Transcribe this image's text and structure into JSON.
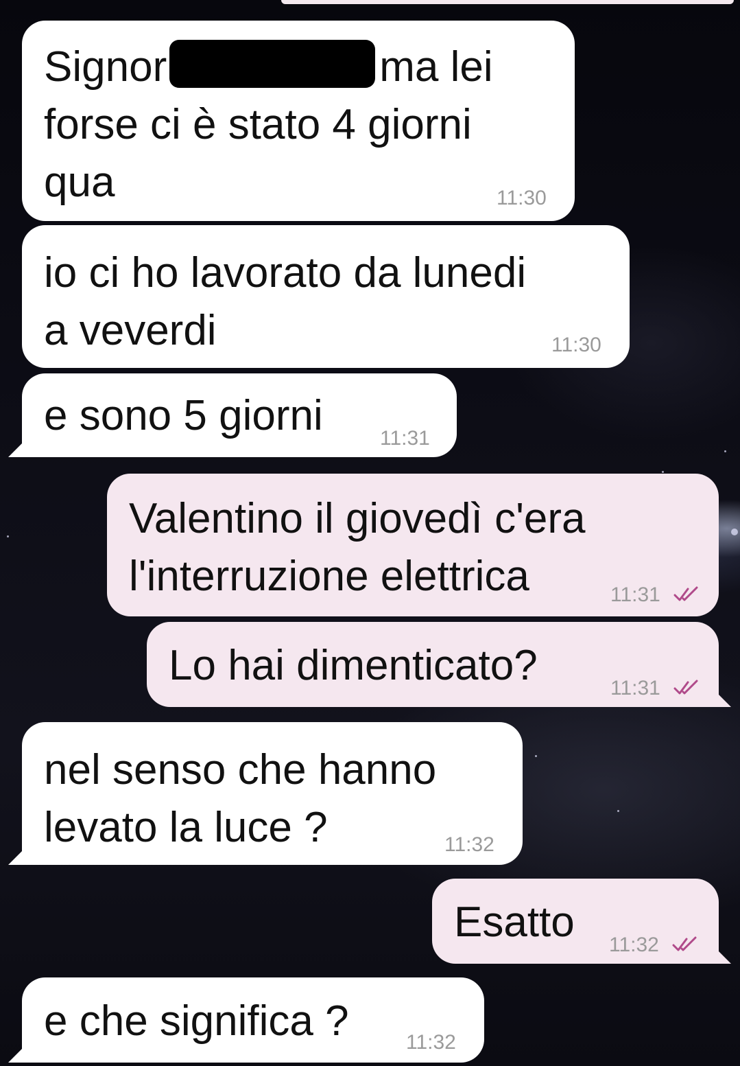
{
  "messages": [
    {
      "id": "m1",
      "direction": "in",
      "before_redaction": "Signor",
      "after_redaction": "ma lei",
      "text_rest": "forse ci è stato 4 giorni\nqua",
      "time": "11:30"
    },
    {
      "id": "m2",
      "direction": "in",
      "text": "io ci ho lavorato da lunedi\na veverdi",
      "time": "11:30"
    },
    {
      "id": "m3",
      "direction": "in",
      "text": "e sono 5 giorni",
      "time": "11:31"
    },
    {
      "id": "m4",
      "direction": "out",
      "text": "Valentino il giovedì c'era\nl'interruzione elettrica",
      "time": "11:31",
      "status": "read"
    },
    {
      "id": "m5",
      "direction": "out",
      "text": "Lo hai dimenticato?",
      "time": "11:31",
      "status": "read"
    },
    {
      "id": "m6",
      "direction": "in",
      "text": "nel senso che hanno\nlevato la luce ?",
      "time": "11:32"
    },
    {
      "id": "m7",
      "direction": "out",
      "text": "Esatto",
      "time": "11:32",
      "status": "read"
    },
    {
      "id": "m8",
      "direction": "in",
      "text": "e che significa ?",
      "time": "11:32"
    }
  ],
  "colors": {
    "incoming_bubble": "#ffffff",
    "outgoing_bubble": "#f5e7ef",
    "read_check": "#b04a8a",
    "timestamp": "#9a9a9a"
  },
  "icons": {
    "read_status": "double-check-icon"
  }
}
